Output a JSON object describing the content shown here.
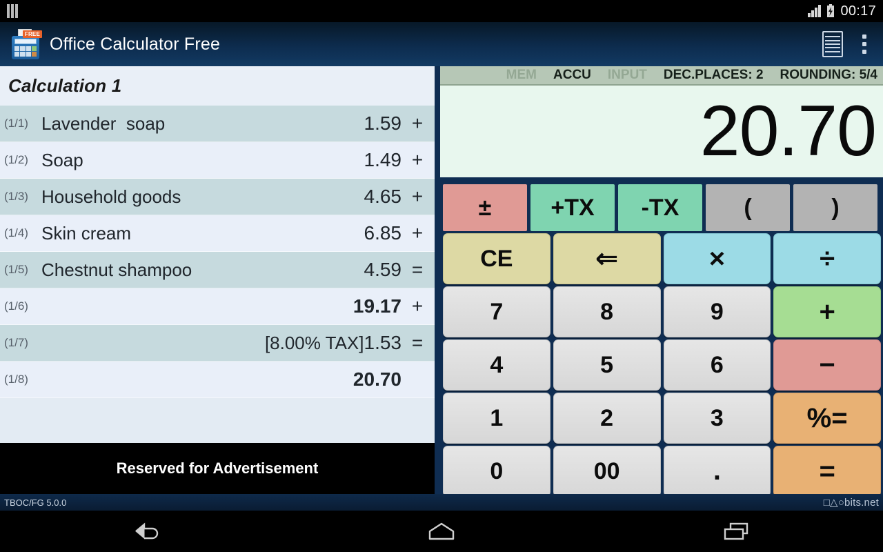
{
  "statusbar": {
    "left_icon": "menu-bars-icon",
    "signal_icon": "signal-bars-icon",
    "battery_icon": "battery-charging-icon",
    "clock": "00:17"
  },
  "actionbar": {
    "app_icon": "calculator-app-icon",
    "badge": "FREE",
    "title": "Office Calculator Free",
    "tape_action": "tape-list-icon",
    "overflow_action": "overflow-menu-icon"
  },
  "tape": {
    "title": "Calculation 1",
    "rows": [
      {
        "index": "(1/1)",
        "label": "Lavender  soap",
        "value": "1.59",
        "op": "+",
        "bold": false
      },
      {
        "index": "(1/2)",
        "label": "Soap",
        "value": "1.49",
        "op": "+",
        "bold": false
      },
      {
        "index": "(1/3)",
        "label": "Household goods",
        "value": "4.65",
        "op": "+",
        "bold": false
      },
      {
        "index": "(1/4)",
        "label": "Skin cream",
        "value": "6.85",
        "op": "+",
        "bold": false
      },
      {
        "index": "(1/5)",
        "label": "Chestnut shampoo",
        "value": "4.59",
        "op": "=",
        "bold": false
      },
      {
        "index": "(1/6)",
        "label": "",
        "value": "19.17",
        "op": "+",
        "bold": true
      },
      {
        "index": "(1/7)",
        "label": "[8.00% TAX]",
        "value": "1.53",
        "op": "=",
        "bold": false
      },
      {
        "index": "(1/8)",
        "label": "",
        "value": "20.70",
        "op": "",
        "bold": true
      }
    ],
    "ad_text": "Reserved for Advertisement"
  },
  "calculator": {
    "status": {
      "mem": "MEM",
      "accu": "ACCU",
      "input": "INPUT",
      "dec_places": "DEC.PLACES: 2",
      "rounding": "ROUNDING: 5/4"
    },
    "display_value": "20.70",
    "keys": {
      "row1": [
        "±",
        "+TX",
        "-TX",
        "(",
        ")"
      ],
      "row2": [
        "CE",
        "⇐",
        "×",
        "÷"
      ],
      "row3": [
        "7",
        "8",
        "9",
        "+"
      ],
      "row4": [
        "4",
        "5",
        "6",
        "−"
      ],
      "row5": [
        "1",
        "2",
        "3",
        "%="
      ],
      "row6": [
        "0",
        "00",
        ".",
        "="
      ]
    },
    "more_keys_indicator": "right-arrow-icon"
  },
  "footer": {
    "left": "TBOC/FG 5.0.0",
    "right": "□△○bits.net"
  },
  "navbar": {
    "back": "back-icon",
    "home": "home-icon",
    "recents": "recents-icon"
  },
  "colors": {
    "chrome": "#0f2d52",
    "display_bg": "#e8f7ee",
    "status_strip": "#b6c7b6",
    "row_odd": "#c6dade",
    "row_even": "#e9eff9",
    "accent_green": "#a6dd93",
    "accent_orange": "#e8b174",
    "accent_pink": "#e09a95"
  }
}
